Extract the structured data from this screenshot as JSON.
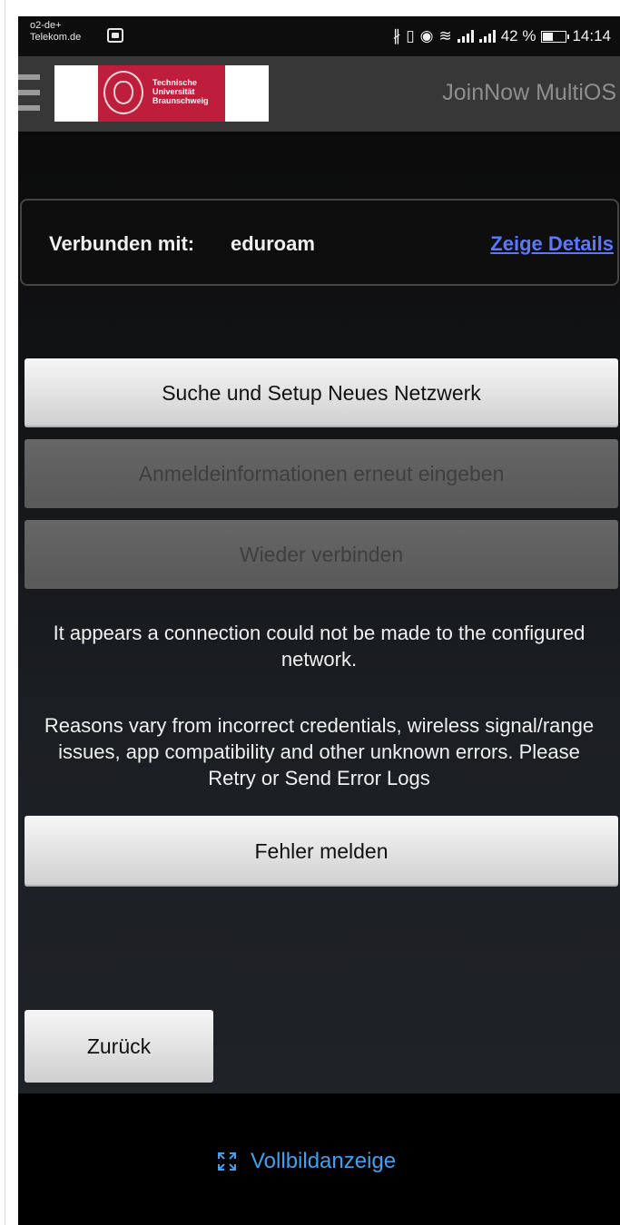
{
  "statusbar": {
    "carrier_line1": "o2-de+",
    "carrier_line2": "Telekom.de",
    "battery_percent": "42 %",
    "time": "14:14"
  },
  "header": {
    "logo_line1": "Technische",
    "logo_line2": "Universität",
    "logo_line3": "Braunschweig",
    "app_title": "JoinNow MultiOS"
  },
  "connection": {
    "label": "Verbunden mit:",
    "ssid": "eduroam",
    "details_link": "Zeige Details"
  },
  "buttons": {
    "setup_new": "Suche und Setup Neues Netzwerk",
    "reenter_credentials": "Anmeldeinformationen erneut eingeben",
    "reconnect": "Wieder verbinden",
    "report_error": "Fehler melden",
    "back": "Zurück"
  },
  "messages": {
    "connection_failed": "It appears a connection could not be made to the configured network.",
    "reasons": "Reasons vary from incorrect credentials, wireless signal/range issues, app compatibility and other unknown errors. Please Retry or Send Error Logs"
  },
  "footer": {
    "fullscreen_label": "Vollbildanzeige"
  },
  "colors": {
    "link": "#5a78ff",
    "fullscreen_link": "#3ea0f0",
    "logo_red": "#be1e3c"
  }
}
